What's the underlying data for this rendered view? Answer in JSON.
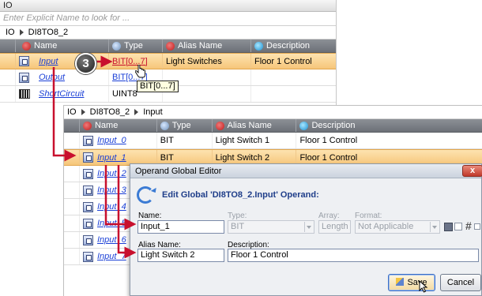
{
  "top_panel": {
    "title": "IO",
    "filter_placeholder": "Enter Explicit Name to look for ...",
    "breadcrumb": [
      "IO",
      "DI8TO8_2"
    ],
    "columns": [
      "Name",
      "Type",
      "Alias Name",
      "Description"
    ],
    "rows": [
      {
        "name": "Input",
        "type": "BIT[0...7]",
        "alias": "Light Switches",
        "description": "Floor 1 Control",
        "selected": true
      },
      {
        "name": "Output",
        "type": "BIT[0...7]",
        "alias": "",
        "description": "",
        "selected": false
      },
      {
        "name": "ShortCircuit",
        "type": "UINT8",
        "alias": "",
        "description": "",
        "selected": false
      }
    ],
    "tooltip": "BIT[0...7]",
    "step_badge": "3"
  },
  "lower_panel": {
    "breadcrumb": [
      "IO",
      "DI8TO8_2",
      "Input"
    ],
    "columns": [
      "Name",
      "Type",
      "Alias Name",
      "Description"
    ],
    "rows": [
      {
        "name": "Input_0",
        "type": "BIT",
        "alias": "Light Switch 1",
        "description": "Floor 1 Control",
        "selected": false
      },
      {
        "name": "Input_1",
        "type": "BIT",
        "alias": "Light Switch 2",
        "description": "Floor 1 Control",
        "selected": true
      },
      {
        "name": "Input_2",
        "selected": false
      },
      {
        "name": "Input_3",
        "selected": false
      },
      {
        "name": "Input_4",
        "selected": false
      },
      {
        "name": "Input_5",
        "selected": false
      },
      {
        "name": "Input_6",
        "selected": false
      },
      {
        "name": "Input_7",
        "selected": false
      }
    ]
  },
  "dialog": {
    "title": "Operand Global Editor",
    "heading": "Edit Global 'DI8TO8_2.Input' Operand:",
    "labels": {
      "name": "Name:",
      "type": "Type:",
      "array": "Array:",
      "format": "Format:",
      "alias": "Alias Name:",
      "description": "Description:"
    },
    "values": {
      "name": "Input_1",
      "type": "BIT",
      "array": "Length",
      "format": "Not Applicable",
      "alias": "Light Switch 2",
      "description": "Floor 1 Control"
    },
    "buttons": {
      "save": "Save",
      "cancel": "Cancel",
      "close": "x"
    }
  },
  "colors": {
    "selected_row": "#f6c67a",
    "link": "#1a3fd6",
    "annotation_arrow": "#c8102e",
    "dialog_heading": "#1f3e8a",
    "grid_header": "#7a7e85"
  },
  "icons": {
    "signal": "signal-icon",
    "array": "array-icon",
    "refresh": "refresh-icon",
    "save": "save-icon",
    "hash": "hash-icon",
    "pencil": "pencil-icon",
    "hand_cursor": "hand-cursor-icon",
    "arrow_cursor": "arrow-cursor-icon"
  }
}
